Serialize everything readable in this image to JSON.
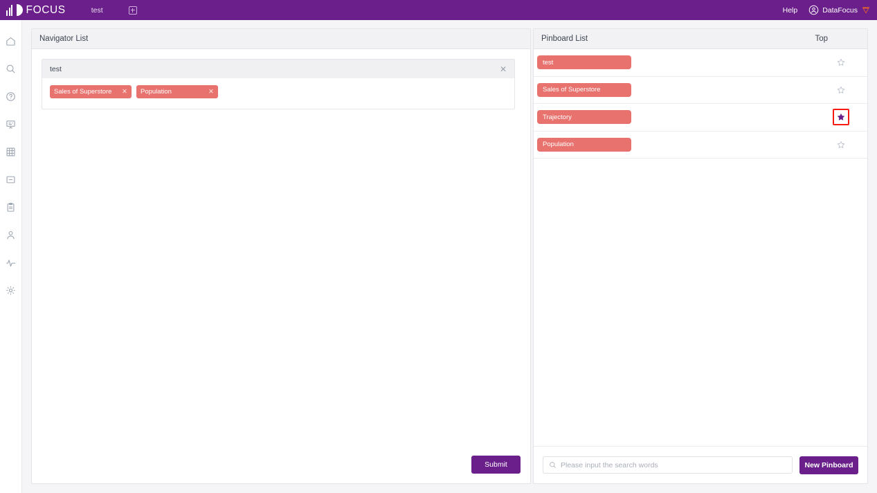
{
  "header": {
    "logo_text": "FOCUS",
    "tab_label": "test",
    "add_tab_icon": "plus-box-icon",
    "help_label": "Help",
    "user_name": "DataFocus",
    "avatar_icon": "user-avatar-icon",
    "brand_badge_icon": "datafocus-badge-icon",
    "background_color": "#6b1f8a"
  },
  "sidebar": {
    "items": [
      {
        "icon": "home-icon",
        "name": "sidebar-item-home"
      },
      {
        "icon": "search-icon",
        "name": "sidebar-item-search"
      },
      {
        "icon": "question-circle-icon",
        "name": "sidebar-item-help"
      },
      {
        "icon": "presentation-icon",
        "name": "sidebar-item-presentation"
      },
      {
        "icon": "table-grid-icon",
        "name": "sidebar-item-table"
      },
      {
        "icon": "minus-box-icon",
        "name": "sidebar-item-collapse"
      },
      {
        "icon": "clipboard-icon",
        "name": "sidebar-item-clipboard"
      },
      {
        "icon": "user-icon",
        "name": "sidebar-item-user"
      },
      {
        "icon": "pulse-icon",
        "name": "sidebar-item-activity"
      },
      {
        "icon": "gear-icon",
        "name": "sidebar-item-settings"
      }
    ]
  },
  "navigator": {
    "title": "Navigator List",
    "card": {
      "title": "test",
      "close_icon": "close-icon",
      "chips": [
        {
          "label": "Sales of Superstore",
          "close_icon": "close-icon"
        },
        {
          "label": "Population",
          "close_icon": "close-icon"
        }
      ]
    },
    "submit_label": "Submit"
  },
  "pinboard": {
    "title": "Pinboard List",
    "top_column_label": "Top",
    "rows": [
      {
        "label": "test",
        "starred": false,
        "highlighted": false
      },
      {
        "label": "Sales of Superstore",
        "starred": false,
        "highlighted": false
      },
      {
        "label": "Trajectory",
        "starred": true,
        "highlighted": true
      },
      {
        "label": "Population",
        "starred": false,
        "highlighted": false
      }
    ],
    "search": {
      "placeholder": "Please input the search words",
      "value": "",
      "icon": "search-icon"
    },
    "new_pinboard_label": "New Pinboard"
  },
  "colors": {
    "brand_purple": "#6b1f8a",
    "chip_red": "#e8726e",
    "highlight_red": "#f61b12",
    "star_filled": "#6b1f8a",
    "page_bg": "#f5f5f7"
  }
}
